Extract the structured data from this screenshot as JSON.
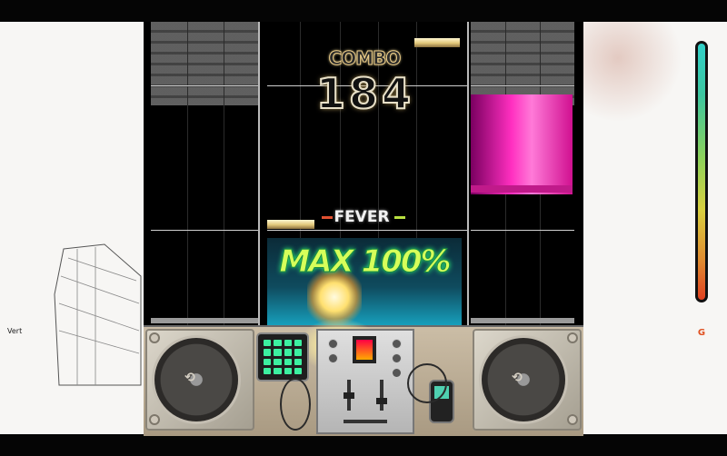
{
  "hud": {
    "combo_label": "COMBO",
    "combo_count": "184",
    "fever_label": "FEVER",
    "fever_status": "MAX 100%"
  },
  "side_panel": {
    "label": "Vert"
  },
  "gauge": {
    "grade_mark": "G",
    "level_fraction": 1.0
  },
  "colors": {
    "long_note": "#ff2fc0",
    "fever_text": "#d6ff5a",
    "note_bar": "#e2c77a"
  },
  "icons": [
    "turntable-left-icon",
    "turntable-right-icon",
    "drum-pad-icon",
    "mixer-icon",
    "media-player-icon"
  ]
}
